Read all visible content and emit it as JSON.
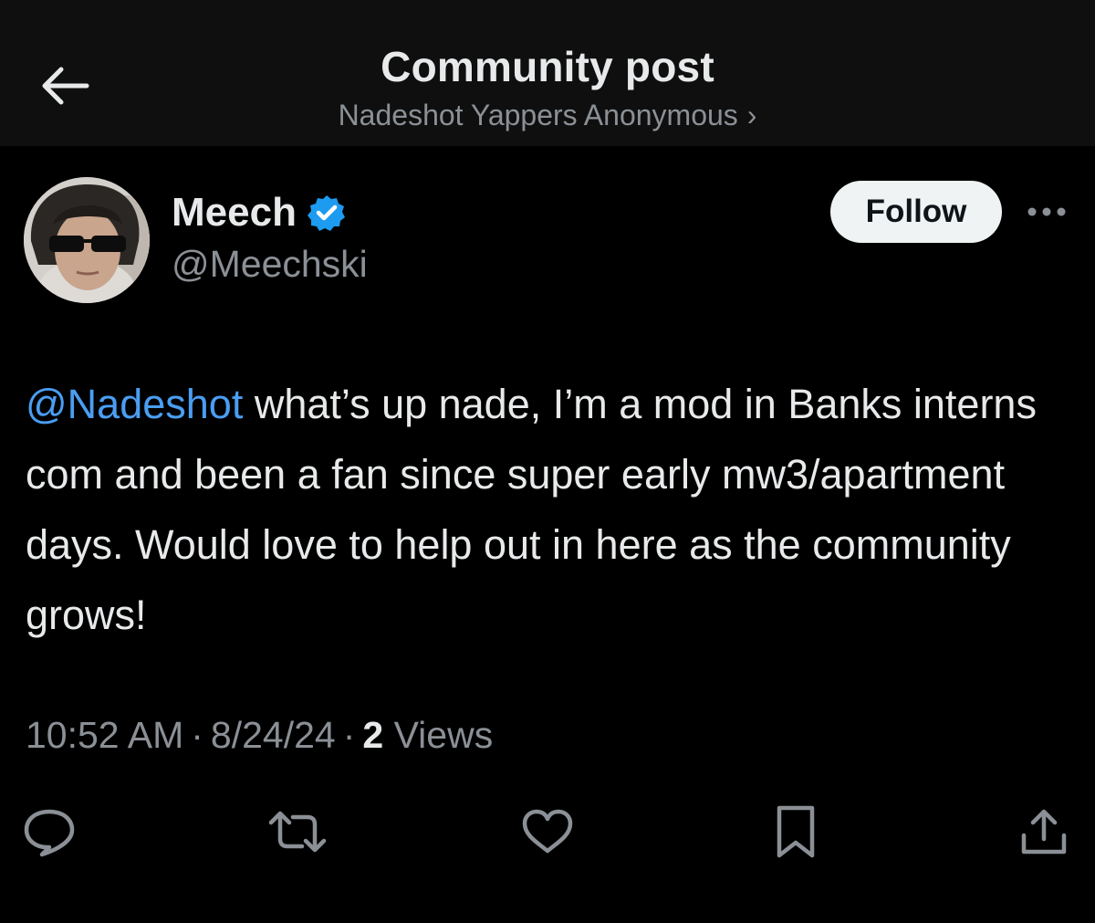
{
  "header": {
    "title": "Community post",
    "community_name": "Nadeshot Yappers Anonymous",
    "community_chevron": "›"
  },
  "author": {
    "display_name": "Meech",
    "handle": "@Meechski",
    "verified": true
  },
  "follow_label": "Follow",
  "post": {
    "mention": "@Nadeshot",
    "body": " what’s up nade, I’m a mod in Banks interns com and been a fan since super early mw3/apartment days. Would love to help out in here as the community grows!"
  },
  "meta": {
    "time": "10:52 AM",
    "separator": "·",
    "date": "8/24/24",
    "views_count": "2",
    "views_label": "Views"
  },
  "icons": {
    "back": "arrow-left-icon",
    "verified": "verified-badge-icon",
    "more": "more-horizontal-icon",
    "reply": "reply-icon",
    "repost": "repost-icon",
    "like": "heart-icon",
    "bookmark": "bookmark-icon",
    "share": "share-icon"
  },
  "colors": {
    "background": "#000000",
    "header_background": "#0f0f0f",
    "primary_text": "#e7e9ea",
    "secondary_text": "#8b9096",
    "mention": "#4a9ef2",
    "verified_badge": "#1d9bf0",
    "follow_button_bg": "#eff3f4"
  }
}
